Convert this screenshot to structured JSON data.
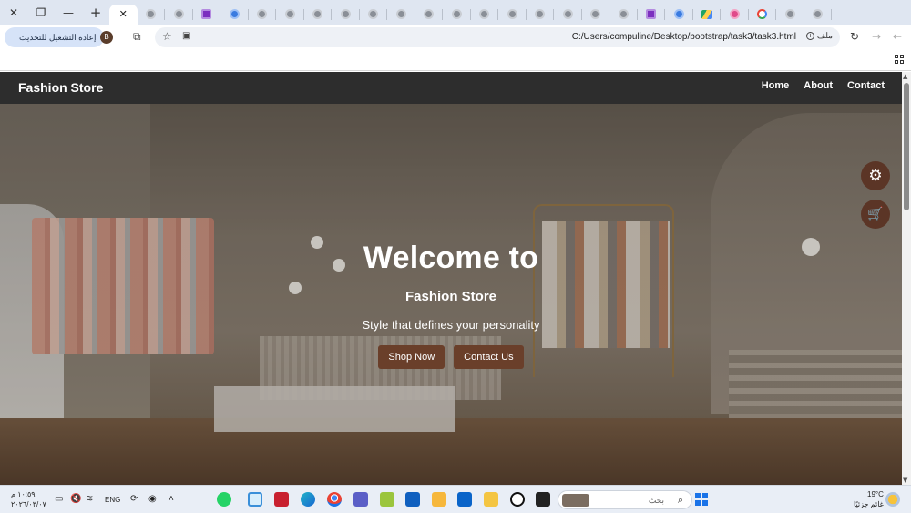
{
  "browser": {
    "window_controls": {
      "close": "✕",
      "restore": "❐",
      "minimize": "—",
      "new_tab": "+"
    },
    "tab_close": "✕",
    "update_button": "إعادة التشغيل للتحديث",
    "profile_initial": "B",
    "url": "C:/Users/compuline/Desktop/bootstrap/task3/task3.html",
    "file_label": "ملف",
    "tabs": [
      "active",
      "gray",
      "gray",
      "purple",
      "blue",
      "gray",
      "gray",
      "gray",
      "gray",
      "gray",
      "gray",
      "gray",
      "gray",
      "gray",
      "gray",
      "gray",
      "gray",
      "gray",
      "gray",
      "purple",
      "blue",
      "drive",
      "heart",
      "google",
      "gray",
      "gray"
    ]
  },
  "site": {
    "brand": "Fashion Store",
    "nav": {
      "home": "Home",
      "about": "About",
      "contact": "Contact"
    },
    "hero": {
      "title": "Welcome to",
      "subtitle": "Fashion Store",
      "tagline": "Style that defines your personality",
      "primary_button": "Shop Now",
      "secondary_button": "Contact Us"
    },
    "floating": {
      "settings_icon": "⚙",
      "cart_icon": "🛒"
    },
    "accent_color": "#6a3f2a"
  },
  "taskbar": {
    "search_placeholder": "بحث",
    "language": "ENG",
    "clock_time": "١٠:٥٩ م",
    "clock_date": "٢٠٢٦/٠٣/٠٧",
    "weather_temp": "19°C",
    "weather_text": "غائم جزئيًا"
  }
}
